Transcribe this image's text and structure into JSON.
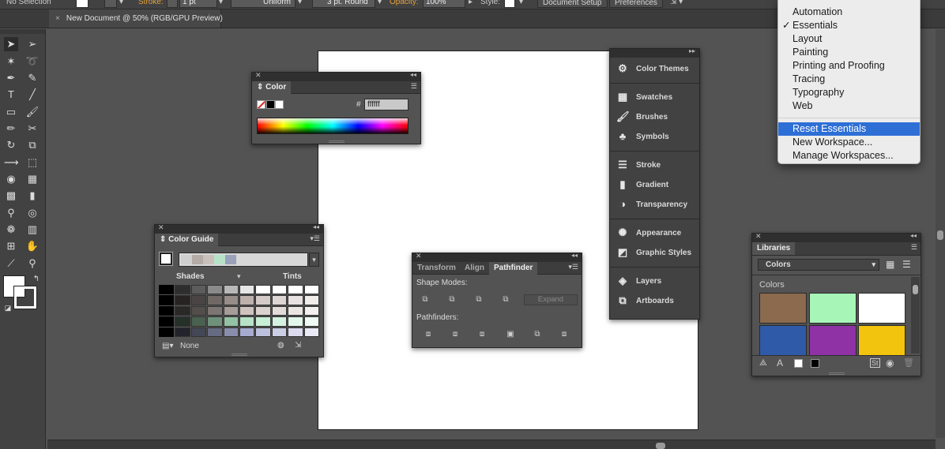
{
  "control_bar": {
    "selection": "No Selection",
    "stroke_label": "Stroke:",
    "stroke_weight": "1 pt",
    "profile": "Uniform",
    "brush": "3 pt. Round",
    "opacity_label": "Opacity:",
    "opacity_value": "100%",
    "style_label": "Style:",
    "document_setup": "Document Setup",
    "preferences": "Preferences",
    "accent_color": "#e8a23a"
  },
  "document": {
    "tab_title": "New Document @ 50% (RGB/GPU Preview)",
    "close_glyph": "×"
  },
  "color_panel": {
    "title": "Color",
    "hex_label": "#",
    "hex_value": "ffffff"
  },
  "color_guide": {
    "title": "Color Guide",
    "shades_label": "Shades",
    "tints_label": "Tints",
    "none_label": "None",
    "harmony_colors": [
      "#cfcfcf",
      "#b4aaa6",
      "#c9c0bc",
      "#b7e2c7",
      "#9ba0bb"
    ],
    "grid": [
      [
        "#000000",
        "#2e2e2e",
        "#5c5c5c",
        "#8a8a8a",
        "#b8b8b8",
        "#e6e6e6",
        "#ffffff",
        "#ffffff",
        "#ffffff",
        "#ffffff"
      ],
      [
        "#000000",
        "#262321",
        "#4a4542",
        "#706865",
        "#978d89",
        "#beb1ad",
        "#d4cac7",
        "#ddd5d3",
        "#e7e1df",
        "#f0ecea"
      ],
      [
        "#000000",
        "#2a2826",
        "#534e4b",
        "#7d7572",
        "#a69c98",
        "#cfc3bf",
        "#dbd1ce",
        "#e3dbd9",
        "#ebe6e4",
        "#f3f0ef"
      ],
      [
        "#000000",
        "#253029",
        "#4a6152",
        "#6f917b",
        "#94c2a4",
        "#b7e2c7",
        "#c8eed6",
        "#d5f2e0",
        "#e3f6ea",
        "#f0faf4"
      ],
      [
        "#000000",
        "#22232b",
        "#444756",
        "#676b81",
        "#898eac",
        "#a7abd0",
        "#bcc0dc",
        "#cbcee4",
        "#dadced",
        "#e9eaf5"
      ]
    ]
  },
  "pathfinder_panel": {
    "tabs": [
      "Transform",
      "Align",
      "Pathfinder"
    ],
    "active_tab": "Pathfinder",
    "shape_modes_label": "Shape Modes:",
    "expand_label": "Expand",
    "pathfinders_label": "Pathfinders:"
  },
  "dock": {
    "groups": [
      [
        {
          "label": "Color Themes",
          "icon": "color-themes-icon"
        }
      ],
      [
        {
          "label": "Swatches",
          "icon": "swatches-icon"
        },
        {
          "label": "Brushes",
          "icon": "brushes-icon"
        },
        {
          "label": "Symbols",
          "icon": "symbols-icon"
        }
      ],
      [
        {
          "label": "Stroke",
          "icon": "stroke-icon"
        },
        {
          "label": "Gradient",
          "icon": "gradient-icon"
        },
        {
          "label": "Transparency",
          "icon": "transparency-icon"
        }
      ],
      [
        {
          "label": "Appearance",
          "icon": "appearance-icon"
        },
        {
          "label": "Graphic Styles",
          "icon": "graphic-styles-icon"
        }
      ],
      [
        {
          "label": "Layers",
          "icon": "layers-icon"
        },
        {
          "label": "Artboards",
          "icon": "artboards-icon"
        }
      ]
    ]
  },
  "workspace_menu": {
    "items": [
      "Automation",
      "Essentials",
      "Layout",
      "Painting",
      "Printing and Proofing",
      "Tracing",
      "Typography",
      "Web"
    ],
    "checked": "Essentials",
    "actions": [
      "Reset Essentials",
      "New Workspace...",
      "Manage Workspaces..."
    ],
    "highlighted": "Reset Essentials",
    "highlight_color": "#2e6fd6"
  },
  "libraries_panel": {
    "title": "Libraries",
    "library_select": "Colors",
    "section_label": "Colors",
    "swatches": [
      "#8b6a4e",
      "#a8f5b8",
      "#ffffff",
      "#2f5aa8",
      "#8e32a6",
      "#f2c40e"
    ]
  }
}
